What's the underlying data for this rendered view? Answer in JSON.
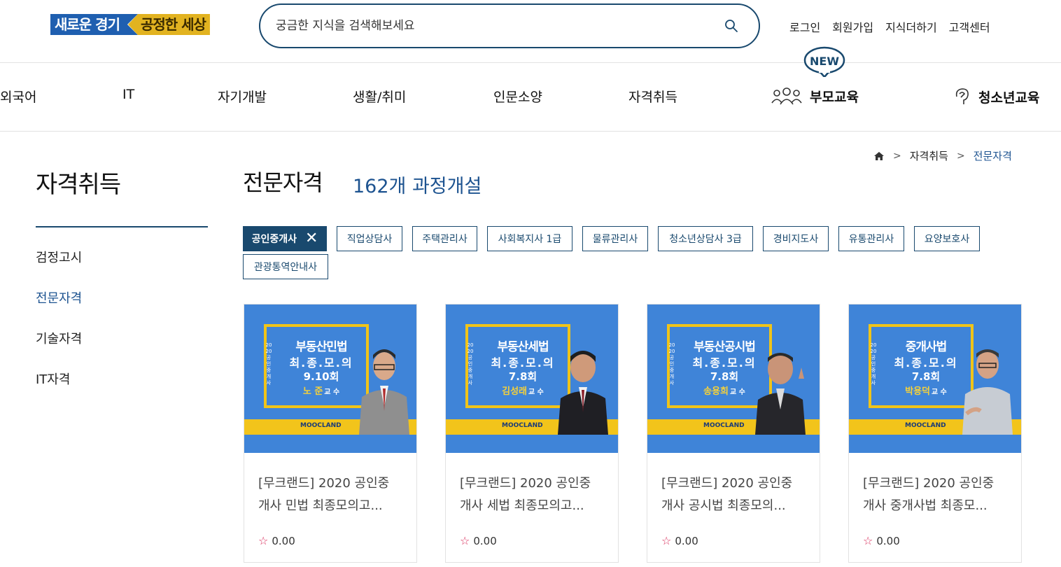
{
  "header": {
    "logo_part1": "새로운 경기",
    "logo_part2": "공정한 세상",
    "search_placeholder": "궁금한 지식을 검색해보세요",
    "util_links": [
      "로그인",
      "회원가입",
      "지식더하기",
      "고객센터"
    ]
  },
  "gnb": {
    "items": [
      "외국어",
      "IT",
      "자기개발",
      "생활/취미",
      "인문소양",
      "자격취득"
    ],
    "parent_edu": "부모교육",
    "teen_edu": "청소년교육",
    "new_badge": "NEW"
  },
  "breadcrumb": {
    "items": [
      "자격취득",
      "전문자격"
    ]
  },
  "sidebar": {
    "title": "자격취득",
    "items": [
      "검정고시",
      "전문자격",
      "기술자격",
      "IT자격"
    ],
    "active_index": 1
  },
  "main": {
    "title": "전문자격",
    "course_count": "162개 과정개설",
    "chips": [
      "공인중개사",
      "직업상담사",
      "주택관리사",
      "사회복지사 1급",
      "물류관리사",
      "청소년상담사 3급",
      "경비지도사",
      "유통관리사",
      "요양보호사",
      "관광통역안내사"
    ],
    "active_chip": 0
  },
  "cards": [
    {
      "title": "[무크랜드] 2020 공인중개사 민법 최종모의고...",
      "title_line1": "[무크랜드] 2020 공인중",
      "title_line2": "개사 민법 최종모의고...",
      "rating": "0.00",
      "thumb_subject": "부동산민법",
      "thumb_sub": "최.종.모.의",
      "thumb_round": "9.10회",
      "thumb_teacher": "노 준",
      "thumb_teacher_suffix": "교 수",
      "thumb_vertical": "2020공인중개사",
      "thumb_brand": "MOOCLAND"
    },
    {
      "title": "[무크랜드] 2020 공인중개사 세법 최종모의고...",
      "title_line1": "[무크랜드] 2020 공인중",
      "title_line2": "개사 세법 최종모의고...",
      "rating": "0.00",
      "thumb_subject": "부동산세법",
      "thumb_sub": "최.종.모.의",
      "thumb_round": "7.8회",
      "thumb_teacher": "김성래",
      "thumb_teacher_suffix": "교 수",
      "thumb_vertical": "2020공인중개사",
      "thumb_brand": "MOOCLAND"
    },
    {
      "title": "[무크랜드] 2020 공인중개사 공시법 최종모의...",
      "title_line1": "[무크랜드] 2020 공인중",
      "title_line2": "개사 공시법 최종모의...",
      "rating": "0.00",
      "thumb_subject": "부동산공시법",
      "thumb_sub": "최.종.모.의",
      "thumb_round": "7.8회",
      "thumb_teacher": "송용희",
      "thumb_teacher_suffix": "교 수",
      "thumb_vertical": "2020공인중개사",
      "thumb_brand": "MOOCLAND"
    },
    {
      "title": "[무크랜드] 2020 공인중개사 중개사법 최종모...",
      "title_line1": "[무크랜드] 2020 공인중",
      "title_line2": "개사 중개사법 최종모...",
      "rating": "0.00",
      "thumb_subject": "중개사법",
      "thumb_sub": "최.종.모.의",
      "thumb_round": "7.8회",
      "thumb_teacher": "박용덕",
      "thumb_teacher_suffix": "교 수",
      "thumb_vertical": "2020공인중개사",
      "thumb_brand": "MOOCLAND"
    }
  ],
  "colors": {
    "primary": "#19496e",
    "link_active": "#1d5390",
    "thumb_bg": "#3f84d8",
    "thumb_accent": "#f2c41b",
    "star": "#d82c5a"
  }
}
